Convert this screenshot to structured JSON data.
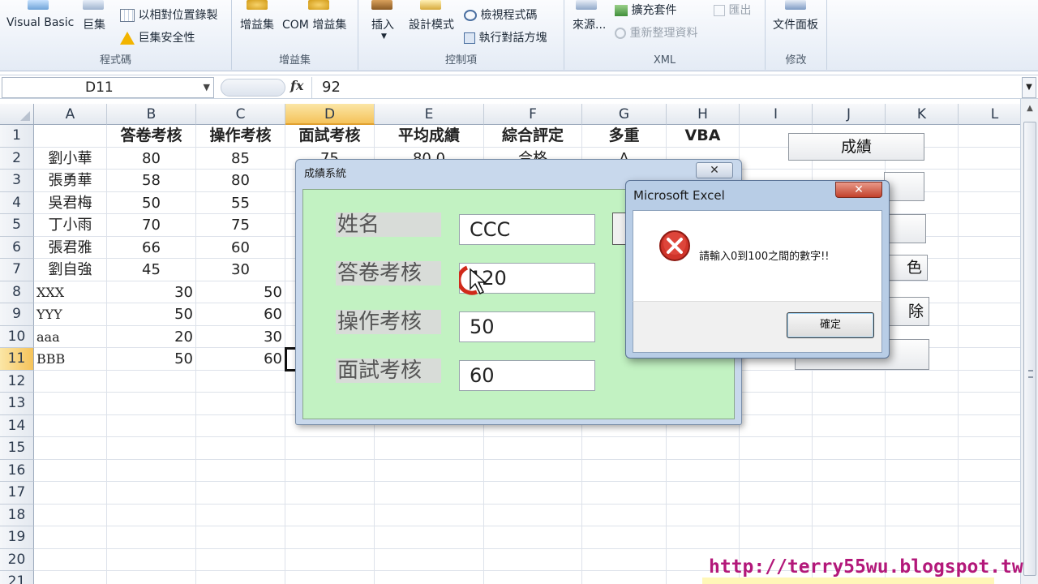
{
  "ribbon": {
    "visual_basic": "Visual Basic",
    "macros": "巨集",
    "record_relative": "以相對位置錄製",
    "macro_security": "巨集安全性",
    "addins": "增益集",
    "com_addins": "COM 增益集",
    "insert": "插入",
    "design_mode": "設計模式",
    "view_code": "檢視程式碼",
    "run_dialog": "執行對話方塊",
    "source": "來源...",
    "expansion_packs": "擴充套件",
    "refresh_data": "重新整理資料",
    "export": "匯出",
    "doc_panel": "文件面板",
    "groups": {
      "code": "程式碼",
      "addins": "增益集",
      "controls": "控制項",
      "xml": "XML",
      "modify": "修改"
    }
  },
  "formula_bar": {
    "name_box": "D11",
    "fx": "fx",
    "value": "92"
  },
  "columns": [
    "A",
    "B",
    "C",
    "D",
    "E",
    "F",
    "G",
    "H",
    "I",
    "J",
    "K",
    "L"
  ],
  "rows": [
    "1",
    "2",
    "3",
    "4",
    "5",
    "6",
    "7",
    "8",
    "9",
    "10",
    "11",
    "12",
    "13",
    "14",
    "15",
    "16",
    "17",
    "18",
    "19",
    "20",
    "21"
  ],
  "sheet": {
    "headers": {
      "B1": "答卷考核",
      "C1": "操作考核",
      "D1": "面試考核",
      "E1": "平均成績",
      "F1": "綜合評定",
      "G1": "多重",
      "H1": "VBA"
    },
    "names": [
      "劉小華",
      "張勇華",
      "吳君梅",
      "丁小雨",
      "張君雅",
      "劉自強"
    ],
    "scoreB": [
      "80",
      "58",
      "50",
      "70",
      "66",
      "45"
    ],
    "scoreC": [
      "85",
      "80",
      "55",
      "75",
      "60",
      "30"
    ],
    "extra_rows": [
      {
        "a": "XXX",
        "b": "30",
        "c": "50"
      },
      {
        "a": "YYY",
        "b": "50",
        "c": "60"
      },
      {
        "a": "aaa",
        "b": "20",
        "c": "30"
      },
      {
        "a": "BBB",
        "b": "50",
        "c": "60"
      }
    ],
    "partial_row2": {
      "d": "75",
      "e": "80.0",
      "f": "合格",
      "g": "A"
    }
  },
  "sheet_buttons": {
    "grade": "成績",
    "color_partial": "色",
    "delete_partial": "除"
  },
  "userform": {
    "title": "成績系統",
    "close": "✕",
    "labels": [
      "姓名",
      "答卷考核",
      "操作考核",
      "面試考核"
    ],
    "values": [
      "CCC",
      "120",
      "50",
      "60"
    ]
  },
  "msgbox": {
    "title": "Microsoft Excel",
    "close": "✕",
    "message": "請輸入0到100之間的數字!!",
    "ok": "確定"
  },
  "watermark": "http://terry55wu.blogspot.tw",
  "colors": {
    "form_bg": "#c2f2c2",
    "selected_header": "#f5c35a",
    "error_red": "#d0342a",
    "watermark": "#b3187a"
  }
}
